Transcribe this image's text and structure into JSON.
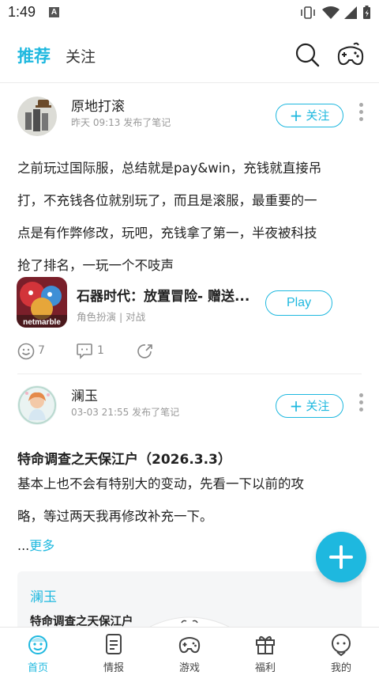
{
  "status_bar": {
    "time": "1:49",
    "notification_icon": "A"
  },
  "top_tabs": {
    "recommend": "推荐",
    "follow": "关注"
  },
  "post1": {
    "username": "原地打滚",
    "meta": "昨天 09:13 发布了笔记",
    "follow_label": "关注",
    "text_lines": [
      "之前玩过国际服，总结就是pay&win，充钱就直接吊",
      "打，不充钱各位就别玩了，而且是滚服，最重要的一",
      "点是有作弊修改，玩吧，充钱拿了第一，半夜被科技",
      "抢了排名，一玩一个不吱声"
    ],
    "game": {
      "title": "石器时代：放置冒险- 赠送...",
      "tags": "角色扮演 | 对战",
      "icon_text": "netmarble",
      "play_label": "Play"
    },
    "likes": "7",
    "comments": "1"
  },
  "post2": {
    "username": "澜玉",
    "meta": "03-03 21:55 发布了笔记",
    "follow_label": "关注",
    "title": "特命调查之天保江户（2026.3.3）",
    "text_lines": [
      "基本上也不会有特别大的变动，先看一下以前的攻",
      "略，等过两天我再修改补充一下。"
    ],
    "more_prefix": "...",
    "more_label": "更多",
    "quote": {
      "name": "澜玉",
      "title": "特命调查之天保江户"
    }
  },
  "bottom_nav": [
    {
      "label": "首页",
      "icon": "home-face-icon",
      "active": true
    },
    {
      "label": "情报",
      "icon": "news-icon",
      "active": false
    },
    {
      "label": "游戏",
      "icon": "gamepad-icon",
      "active": false
    },
    {
      "label": "福利",
      "icon": "gift-icon",
      "active": false
    },
    {
      "label": "我的",
      "icon": "profile-face-icon",
      "active": false
    }
  ],
  "colors": {
    "accent": "#1eb8df",
    "text": "#222222",
    "muted": "#999999"
  }
}
